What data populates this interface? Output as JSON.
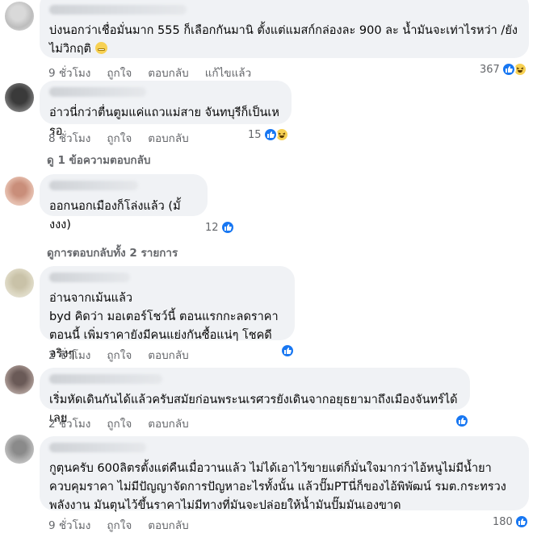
{
  "comments": [
    {
      "text": "บ่งนอกว่าเชื่อมั่นมาก 555 ก็เลือกกันมานิ ตั้งแต่แมสก์กล่องละ 900 ละ น้ำมันจะเท่าไรหว่า /ยังไม่วิกฤติ",
      "time": "9 ชั่วโมง",
      "like": "ถูกใจ",
      "reply": "ตอบกลับ",
      "edited": "แก้ไขแล้ว",
      "reaction_count": "367",
      "reactions": [
        "like",
        "haha"
      ]
    },
    {
      "text": "อ่าวนี่กว่าตื่นตูมแค่แถวแม่สาย จันทบุรีก็เป็นเหรอ",
      "time": "8 ชั่วโมง",
      "like": "ถูกใจ",
      "reply": "ตอบกลับ",
      "reaction_count": "15",
      "reactions": [
        "like",
        "haha"
      ],
      "replies_link": "ดู 1 ข้อความตอบกลับ"
    },
    {
      "text": "ออกนอกเมืองก็โล่งแล้ว (มั้งงง)",
      "reaction_count": "12",
      "reactions": [
        "like"
      ],
      "replies_link": "ดูการตอบกลับทั้ง 2 รายการ"
    },
    {
      "text": "อ่านจากเม้นแล้ว\nbyd คิดว่า มอเตอร์โชว์นี้ ตอนแรกกะลดราคา\nตอนนี้ เพิ่มราคายังมีคนแย่งกันซื้อแน่ๆ โชคดีจริงๆ",
      "time": "2 ชั่วโมง",
      "like": "ถูกใจ",
      "reply": "ตอบกลับ",
      "reactions": [
        "like"
      ]
    },
    {
      "text": "เริ่มหัดเดินกันได้แล้วครับสมัยก่อนพระนเรศวรยังเดินจากอยุธยามาถึงเมืองจันทร์ได้เลย",
      "time": "2 ชั่วโมง",
      "like": "ถูกใจ",
      "reply": "ตอบกลับ",
      "reactions": [
        "like"
      ]
    },
    {
      "text": "กูตุนครับ 600ลิตรตั้งแต่คืนเมื่อวานแล้ว ไม่ได้เอาไว้ขายแต่ก็มั่นใจมากว่าไอ้หนูไม่มีน้ำยาควบคุมราคา ไม่มีปัญญาจัดการปัญหาอะไรทั้งนั้น แล้วปั๊มPTนี่ก็ของไอ้พิพัฒน์ รมต.กระทรวงพลังงาน มันตุนไว้ขึ้นราคาไม่มีทางที่มันจะปล่อยให้น้ำมันปั๊มมันเองขาด",
      "time": "9 ชั่วโมง",
      "like": "ถูกใจ",
      "reply": "ตอบกลับ",
      "reaction_count": "180",
      "reactions": [
        "like"
      ]
    }
  ],
  "colors": {
    "bubble": "#f0f2f5",
    "meta": "#65676b",
    "like_blue": "#1877f2",
    "haha_yellow": "#f7d154"
  }
}
